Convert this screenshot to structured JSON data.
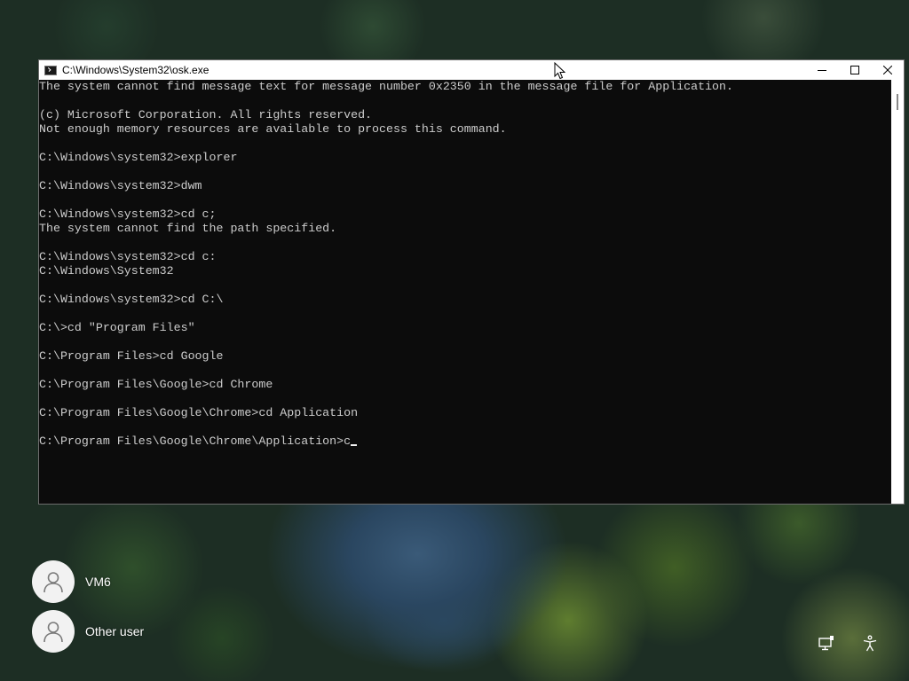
{
  "window": {
    "title": "C:\\Windows\\System32\\osk.exe"
  },
  "console": {
    "lines": [
      "The system cannot find message text for message number 0x2350 in the message file for Application.",
      "",
      "(c) Microsoft Corporation. All rights reserved.",
      "Not enough memory resources are available to process this command.",
      "",
      "C:\\Windows\\system32>explorer",
      "",
      "C:\\Windows\\system32>dwm",
      "",
      "C:\\Windows\\system32>cd c;",
      "The system cannot find the path specified.",
      "",
      "C:\\Windows\\system32>cd c:",
      "C:\\Windows\\System32",
      "",
      "C:\\Windows\\system32>cd C:\\",
      "",
      "C:\\>cd \"Program Files\"",
      "",
      "C:\\Program Files>cd Google",
      "",
      "C:\\Program Files\\Google>cd Chrome",
      "",
      "C:\\Program Files\\Google\\Chrome>cd Application",
      "",
      "C:\\Program Files\\Google\\Chrome\\Application>c"
    ]
  },
  "users": [
    {
      "name": "VM6"
    },
    {
      "name": "Other user"
    }
  ],
  "icons": {
    "window_icon": "console-icon",
    "minimize": "minimize-icon",
    "maximize": "maximize-icon",
    "close": "close-icon",
    "network": "network-icon",
    "accessibility": "accessibility-icon"
  },
  "colors": {
    "console_bg": "#0c0c0c",
    "console_text": "#cccccc",
    "titlebar_bg": "#ffffff"
  }
}
